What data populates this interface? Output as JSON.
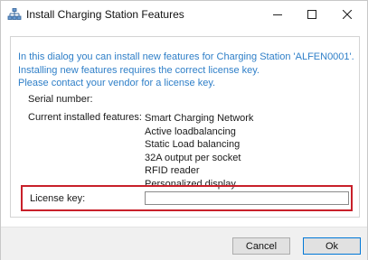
{
  "window": {
    "title": "Install Charging Station Features"
  },
  "icons": {
    "app": "network-icon",
    "minimize": "minimize-icon",
    "maximize": "maximize-icon",
    "close": "close-icon"
  },
  "intro": {
    "line1": "In this dialog you can install new features for Charging Station 'ALFEN0001'.",
    "line2": "Installing new features requires the correct license key.",
    "line3": "Please contact your vendor for a license key."
  },
  "serial": {
    "label": "Serial number:",
    "value": ""
  },
  "features": {
    "label": "Current installed features:",
    "items": [
      "Smart Charging Network",
      "Active loadbalancing",
      "Static Load balancing",
      "32A output per socket",
      "RFID reader",
      "Personalized display"
    ]
  },
  "license": {
    "label": "License key:",
    "value": "",
    "highlight_color": "#c8202a"
  },
  "buttons": {
    "cancel": "Cancel",
    "ok": "Ok"
  },
  "colors": {
    "intro_text": "#2f7fc8",
    "ok_border": "#0078d7"
  }
}
